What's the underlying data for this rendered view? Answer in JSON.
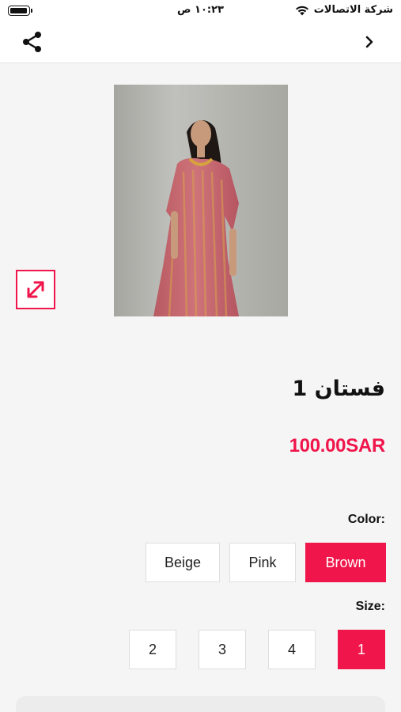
{
  "status_bar": {
    "time": "١٠:٢٣ ص",
    "carrier": "شركة الاتصالات",
    "icons": [
      "battery-icon",
      "wifi-icon"
    ]
  },
  "nav": {
    "icons": [
      "share-icon",
      "chevron-right-icon"
    ]
  },
  "product": {
    "title": "فستان 1",
    "price": "100.00SAR",
    "image_icon": "expand-icon"
  },
  "options": {
    "color_label": "Color:",
    "colors": [
      {
        "label": "Beige",
        "selected": false
      },
      {
        "label": "Pink",
        "selected": false
      },
      {
        "label": "Brown",
        "selected": true
      }
    ],
    "size_label": "Size:",
    "sizes": [
      {
        "label": "2",
        "selected": false
      },
      {
        "label": "3",
        "selected": false
      },
      {
        "label": "4",
        "selected": false
      },
      {
        "label": "1",
        "selected": true
      }
    ]
  },
  "colors": {
    "accent": "#f0154a",
    "background": "#f5f5f5"
  }
}
